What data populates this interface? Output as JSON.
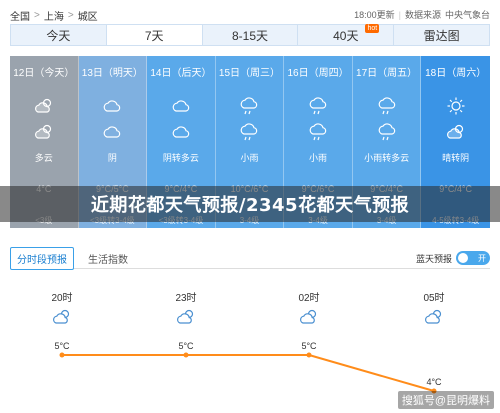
{
  "breadcrumb": [
    "全国",
    "上海",
    "城区"
  ],
  "header": {
    "update_text": "18:00更新",
    "source_label": "数据来源",
    "source_name": "中央气象台"
  },
  "tabs": [
    {
      "label": "今天",
      "active": false
    },
    {
      "label": "7天",
      "active": true
    },
    {
      "label": "8-15天",
      "active": false
    },
    {
      "label": "40天",
      "active": false,
      "badge": "hot"
    },
    {
      "label": "雷达图",
      "active": false
    }
  ],
  "days": [
    {
      "label": "12日（今天）",
      "icon": "cloud-sun-icon",
      "cond": "多云",
      "temp": "4°C",
      "wind": "<3级",
      "color": "#9aa3ad"
    },
    {
      "label": "13日（明天）",
      "icon": "cloud-icon",
      "cond": "阴",
      "temp": "9°C/5°C",
      "wind": "<3级转3-4级",
      "color": "#7fb0e0"
    },
    {
      "label": "14日（后天）",
      "icon": "cloud-icon",
      "cond": "阴转多云",
      "temp": "9°C/4°C",
      "wind": "<3级转3-4级",
      "color": "#5aa9ea"
    },
    {
      "label": "15日（周三）",
      "icon": "rain-icon",
      "cond": "小雨",
      "temp": "10°C/6°C",
      "wind": "3-4级",
      "color": "#5aa9ea"
    },
    {
      "label": "16日（周四）",
      "icon": "rain-icon",
      "cond": "小雨",
      "temp": "9°C/6°C",
      "wind": "3-4级",
      "color": "#5aa9ea"
    },
    {
      "label": "17日（周五）",
      "icon": "rain-icon",
      "cond": "小雨转多云",
      "temp": "9°C/4°C",
      "wind": "3-4级",
      "color": "#5aa9ea"
    },
    {
      "label": "18日（周六）",
      "icon": "sun-icon",
      "cond": "晴转阴",
      "temp": "9°C/4°C",
      "wind": "4-5级转3-4级",
      "color": "#3a94e6"
    }
  ],
  "banner": "近期花都天气预报/2345花都天气预报",
  "subtabs": [
    {
      "label": "分时段预报",
      "active": true
    },
    {
      "label": "生活指数",
      "active": false
    }
  ],
  "toggle": {
    "label": "蓝天预报",
    "state": "开"
  },
  "hourly": [
    {
      "time": "20时",
      "icon": "cloud-sun-icon",
      "temp": "5°C",
      "value": 5
    },
    {
      "time": "23时",
      "icon": "cloud-sun-icon",
      "temp": "5°C",
      "value": 5
    },
    {
      "time": "02时",
      "icon": "cloud-sun-icon",
      "temp": "5°C",
      "value": 5
    },
    {
      "time": "05时",
      "icon": "cloud-sun-icon",
      "temp": "4°C",
      "value": 4
    }
  ],
  "watermark": "搜狐号@昆明爆料",
  "colors": {
    "line": "#ff8c1a",
    "accent": "#3aa0e8"
  }
}
